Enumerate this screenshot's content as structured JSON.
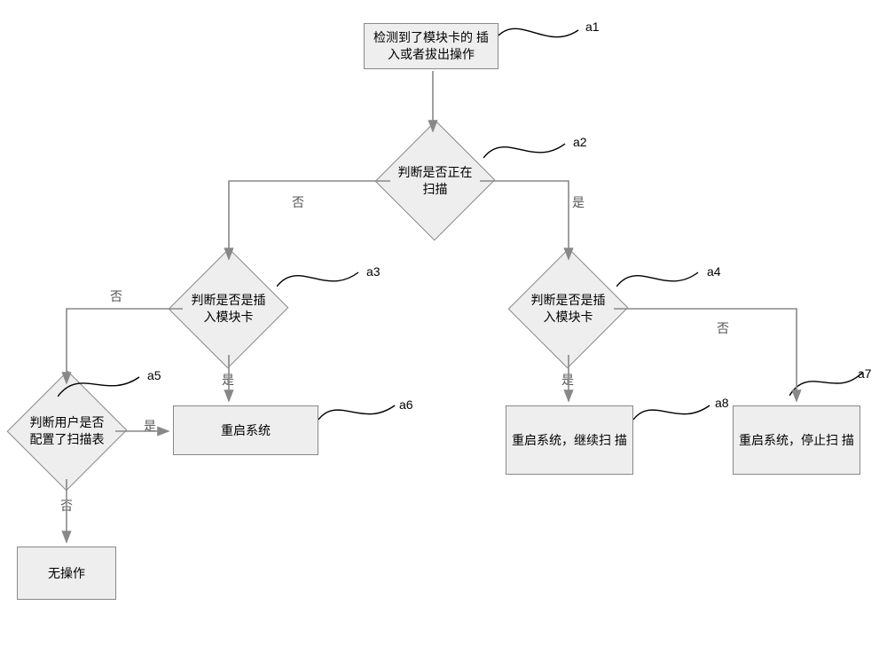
{
  "nodes": {
    "a1": "检测到了模块卡的\n插入或者拔出操作",
    "a2": "判断是否正在\n扫描",
    "a3": "判断是否是插\n入模块卡",
    "a4": "判断是否是插\n入模块卡",
    "a5": "判断用户是否\n配置了扫描表",
    "a6": "重启系统",
    "a7": "重启系统，停止扫\n描",
    "a8": "重启系统，继续扫\n描",
    "noop": "无操作"
  },
  "edges": {
    "yes": "是",
    "no": "否"
  },
  "tags": {
    "a1": "a1",
    "a2": "a2",
    "a3": "a3",
    "a4": "a4",
    "a5": "a5",
    "a6": "a6",
    "a7": "a7",
    "a8": "a8"
  }
}
